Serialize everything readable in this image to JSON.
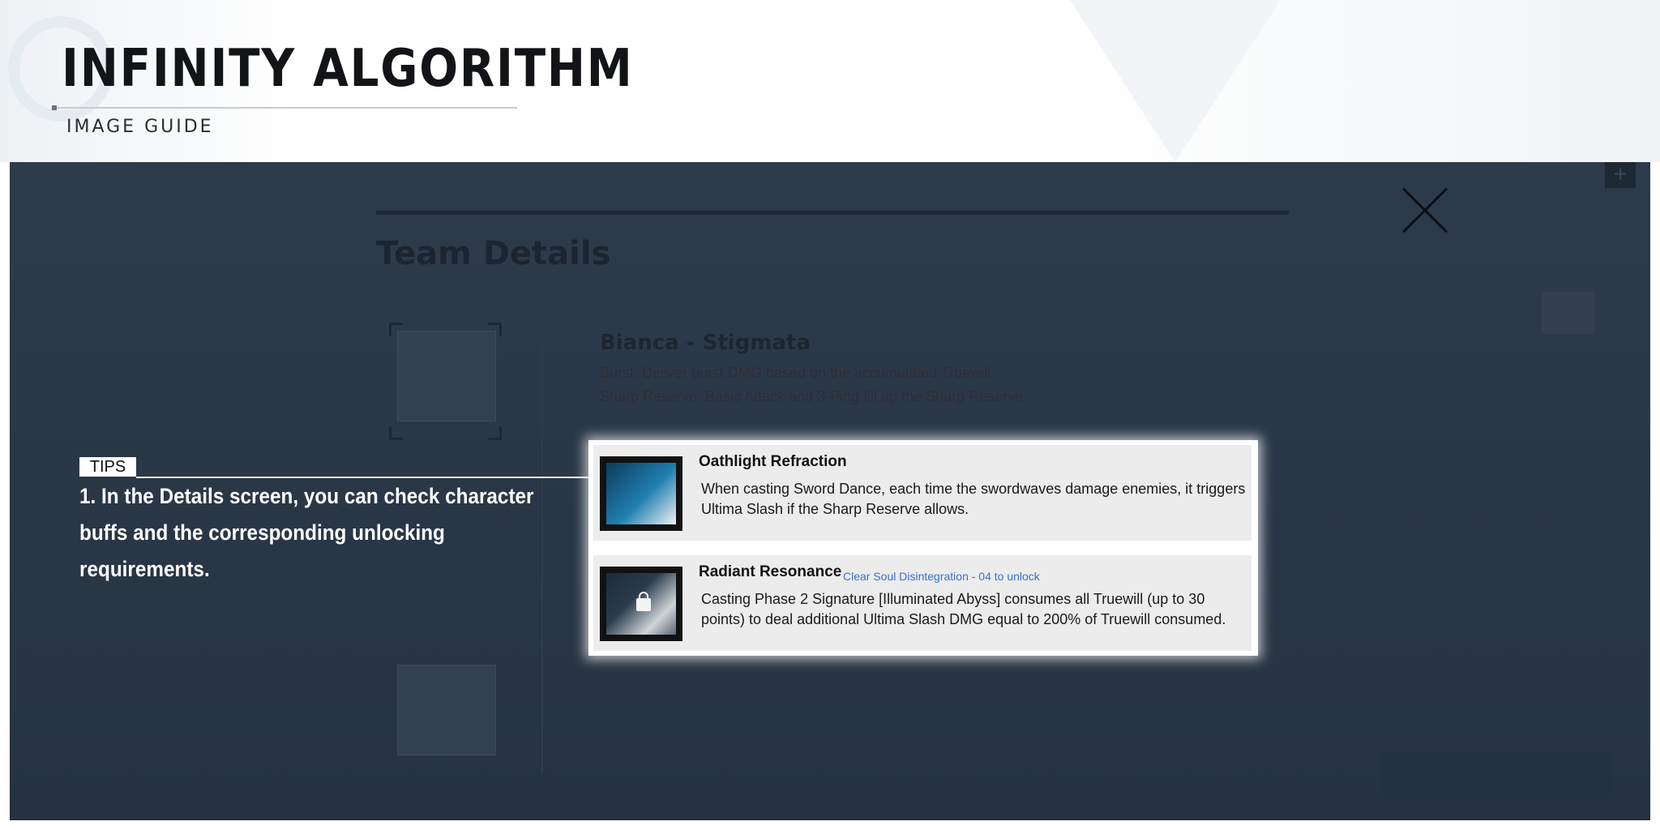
{
  "header": {
    "title": "INFINITY ALGORITHM",
    "subtitle": "IMAGE GUIDE"
  },
  "background_ui": {
    "heading": "Team Details",
    "character_name": "Bianca - Stigmata",
    "desc_lines": [
      "Burst: Deliver burst DMG based on the accumulated Truewill.",
      "Sharp Reserve: Basic Attack and 3-Ping fill up the Sharp Reserve."
    ]
  },
  "tips": {
    "tag": "TIPS",
    "text": "1. In the Details screen, you can check character buffs and the corresponding unlocking requirements."
  },
  "skills": [
    {
      "name": "Oathlight Refraction",
      "unlock": "",
      "icon": "sword-shield-icon",
      "locked": false,
      "description": "When casting Sword Dance, each time the swordwaves damage enemies, it triggers Ultima Slash if the Sharp Reserve allows."
    },
    {
      "name": "Radiant Resonance",
      "unlock": "Clear Soul Disintegration - 04 to unlock",
      "icon": "radiant-burst-icon",
      "locked": true,
      "description": "Casting Phase 2 Signature [Illuminated Abyss] consumes all Truewill (up to 30 points) to deal additional Ultima Slash DMG equal to 200% of Truewill consumed."
    }
  ],
  "colors": {
    "overlay": "#2d3b4a",
    "unlock_text": "#3a6fd0",
    "panel_row": "#ececec"
  }
}
